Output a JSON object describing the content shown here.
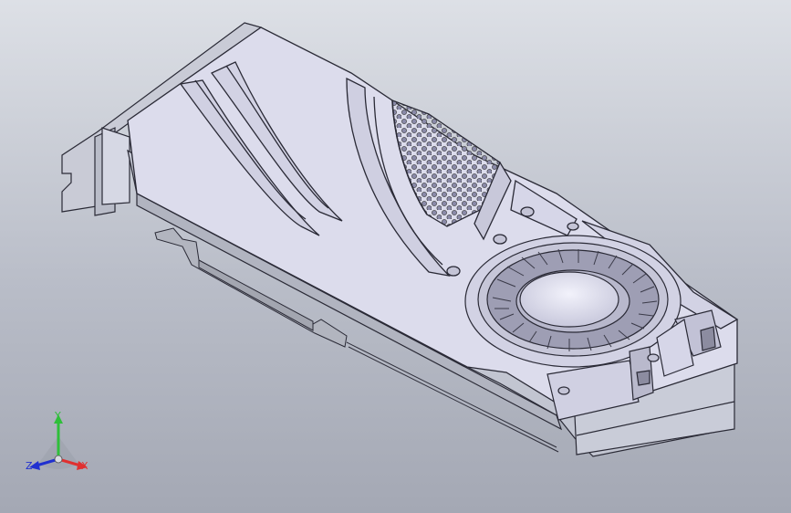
{
  "viewport": {
    "model": "graphics-card-cooler",
    "background_top": "#dde0e6",
    "background_bottom": "#a4a8b4",
    "model_fill": "#dcdcec",
    "model_edge": "#2a2a36"
  },
  "triad": {
    "y_label": "Y",
    "x_label": "X",
    "z_label": "Z",
    "y_color": "#2fbf3a",
    "x_color": "#e03030",
    "z_color": "#2030d0"
  }
}
